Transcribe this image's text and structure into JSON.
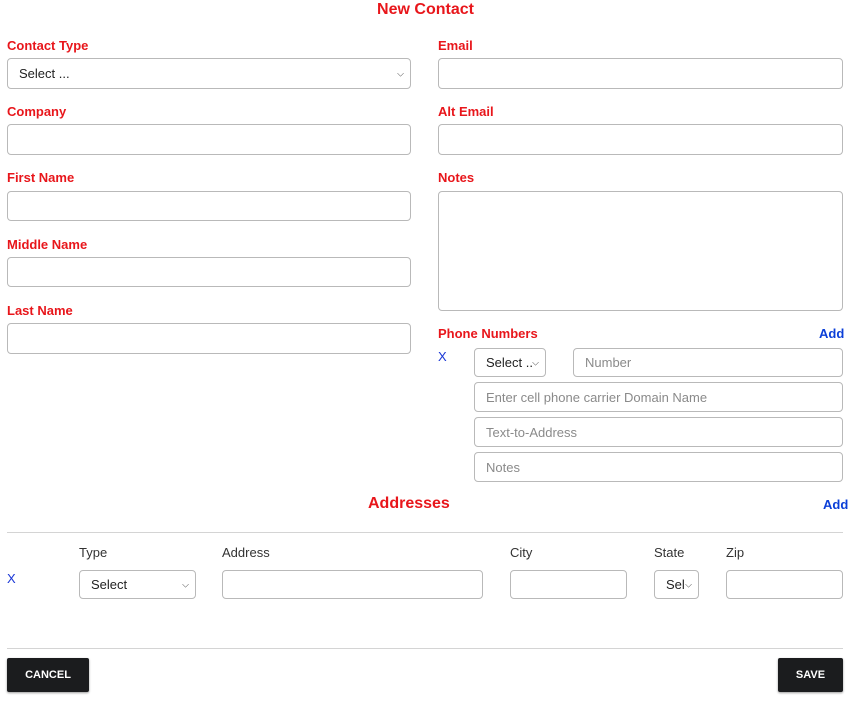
{
  "form": {
    "title": "New Contact"
  },
  "left": {
    "contact_type_label": "Contact Type",
    "contact_type_value": "Select ...",
    "company_label": "Company",
    "first_name_label": "First Name",
    "middle_name_label": "Middle Name",
    "last_name_label": "Last Name"
  },
  "right": {
    "email_label": "Email",
    "alt_email_label": "Alt Email",
    "notes_label": "Notes"
  },
  "phone": {
    "section_label": "Phone Numbers",
    "add_label": "Add",
    "remove_label": "X",
    "type_value": "Select ..",
    "number_placeholder": "Number",
    "carrier_placeholder": "Enter cell phone carrier Domain Name",
    "text_address_placeholder": "Text-to-Address",
    "notes_placeholder": "Notes"
  },
  "addresses": {
    "section_label": "Addresses",
    "add_label": "Add",
    "remove_label": "X",
    "columns": {
      "type": "Type",
      "address": "Address",
      "city": "City",
      "state": "State",
      "zip": "Zip"
    },
    "type_value": "Select",
    "state_value": "Sel"
  },
  "actions": {
    "cancel_label": "CANCEL",
    "save_label": "SAVE"
  }
}
